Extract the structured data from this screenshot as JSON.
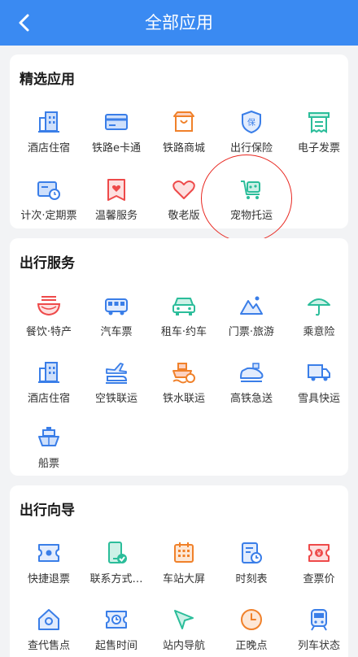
{
  "header": {
    "title": "全部应用"
  },
  "sections": [
    {
      "title": "精选应用",
      "items": [
        {
          "label": "酒店住宿",
          "icon": "hotel-icon"
        },
        {
          "label": "铁路e卡通",
          "icon": "card-icon"
        },
        {
          "label": "铁路商城",
          "icon": "shop-icon"
        },
        {
          "label": "出行保险",
          "icon": "insurance-shield-icon"
        },
        {
          "label": "电子发票",
          "icon": "invoice-icon"
        },
        {
          "label": "计次·定期票",
          "icon": "ticket-card-icon"
        },
        {
          "label": "温馨服务",
          "icon": "heart-bookmark-icon"
        },
        {
          "label": "敬老版",
          "icon": "heart-icon"
        },
        {
          "label": "宠物托运",
          "icon": "pet-cart-icon"
        }
      ]
    },
    {
      "title": "出行服务",
      "items": [
        {
          "label": "餐饮·特产",
          "icon": "noodle-bowl-icon"
        },
        {
          "label": "汽车票",
          "icon": "bus-icon"
        },
        {
          "label": "租车·约车",
          "icon": "car-icon"
        },
        {
          "label": "门票·旅游",
          "icon": "mountain-icon"
        },
        {
          "label": "乘意险",
          "icon": "umbrella-icon"
        },
        {
          "label": "酒店住宿",
          "icon": "hotel-icon"
        },
        {
          "label": "空铁联运",
          "icon": "plane-train-icon"
        },
        {
          "label": "铁水联运",
          "icon": "ship-train-icon"
        },
        {
          "label": "高铁急送",
          "icon": "high-speed-train-icon"
        },
        {
          "label": "雪具快运",
          "icon": "truck-icon"
        },
        {
          "label": "船票",
          "icon": "ship-icon"
        }
      ]
    },
    {
      "title": "出行向导",
      "items": [
        {
          "label": "快捷退票",
          "icon": "refund-ticket-icon"
        },
        {
          "label": "联系方式…",
          "icon": "phone-check-icon"
        },
        {
          "label": "车站大屏",
          "icon": "calendar-grid-icon"
        },
        {
          "label": "时刻表",
          "icon": "timetable-icon"
        },
        {
          "label": "查票价",
          "icon": "price-yen-icon"
        },
        {
          "label": "查代售点",
          "icon": "house-location-icon"
        },
        {
          "label": "起售时间",
          "icon": "clock-ticket-icon"
        },
        {
          "label": "站内导航",
          "icon": "navigation-arrow-icon"
        },
        {
          "label": "正晚点",
          "icon": "clock-icon"
        },
        {
          "label": "列车状态",
          "icon": "train-front-icon"
        }
      ]
    }
  ],
  "colors": {
    "header": "#3a8af2",
    "blue": "#3a7ee8",
    "orange": "#f0812a",
    "red": "#ee4a4a",
    "green": "#2bbd9a",
    "highlight": "#e8261f"
  }
}
